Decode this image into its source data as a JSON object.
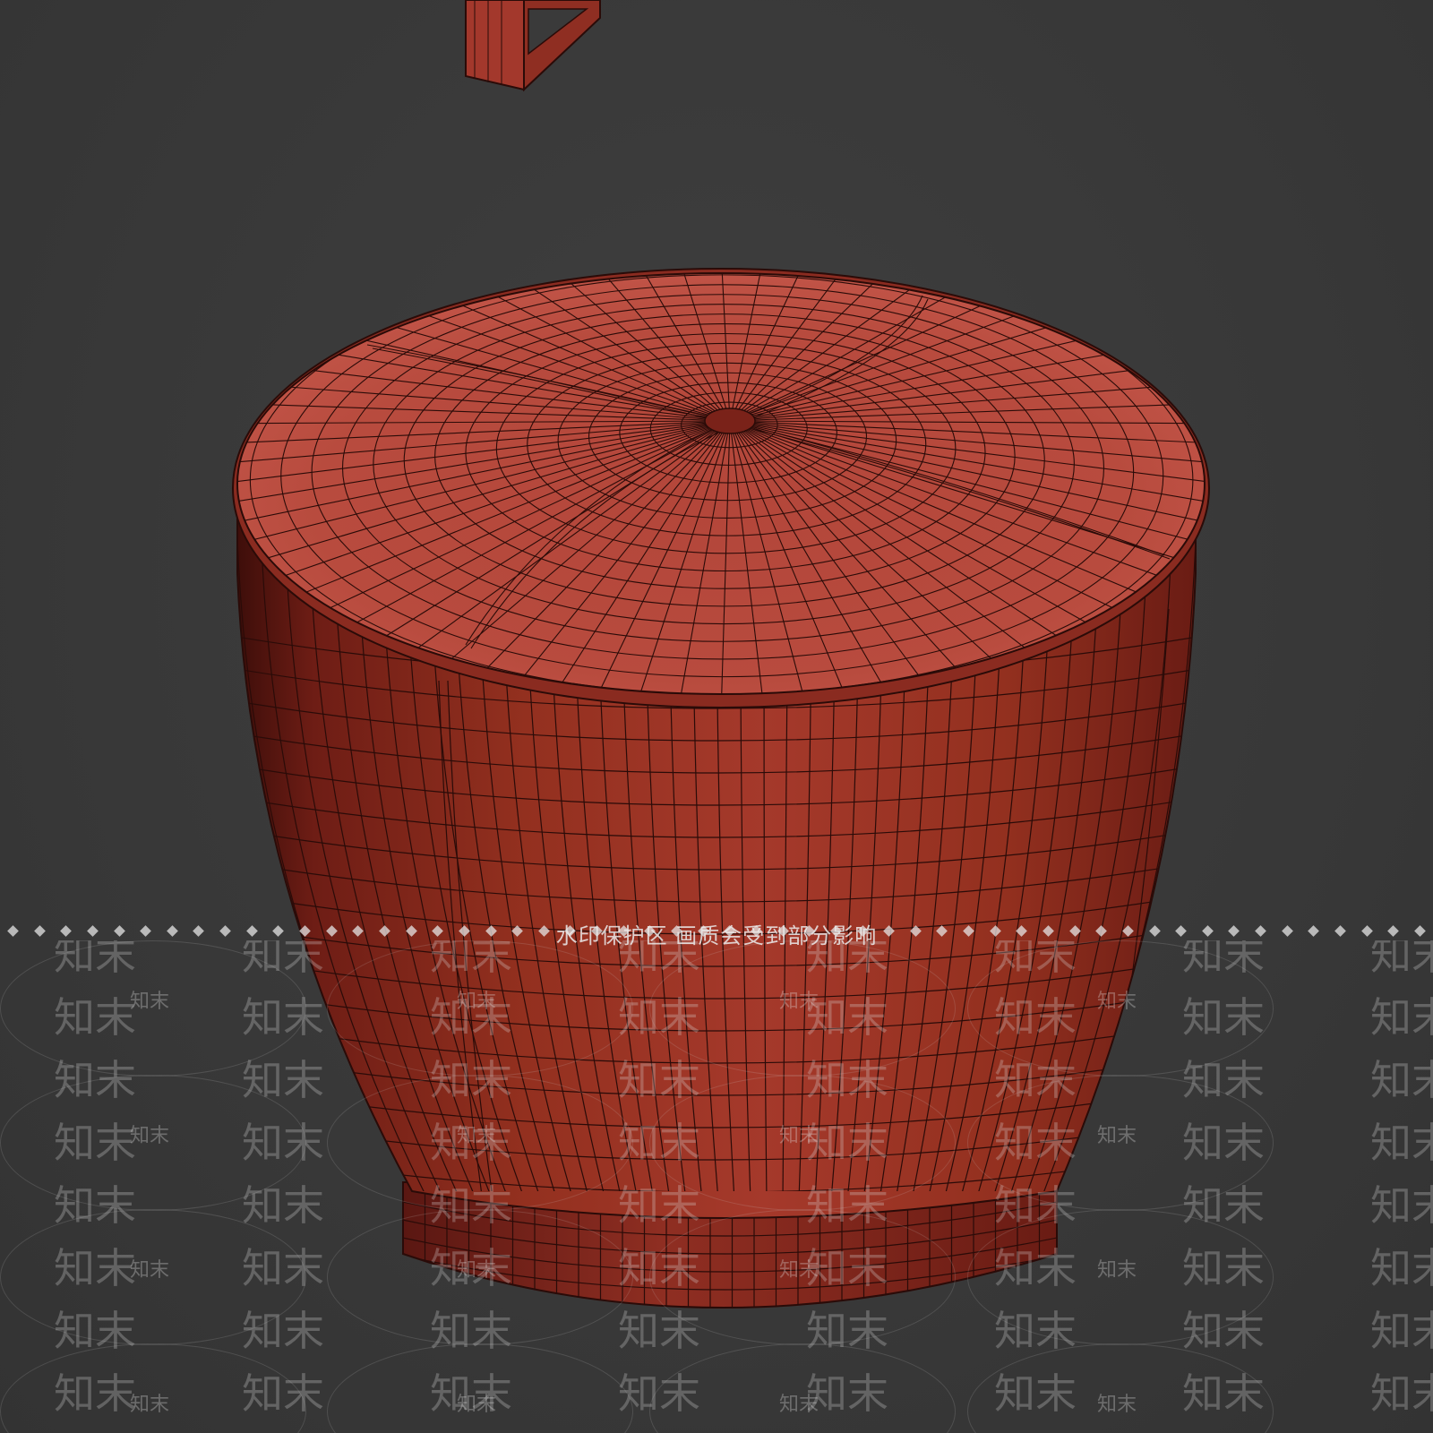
{
  "viewport": {
    "background_color": "#3a3a3a",
    "subject": "ottoman-wireframe"
  },
  "model": {
    "surface_color": "#a3382c",
    "highlight_color": "#c9564a",
    "shadow_color": "#5a1712",
    "wire_color": "#2a0b08"
  },
  "watermark": {
    "band_text": "水印保护区   画质会受到部分影响",
    "tile_text": "知末",
    "small_text": "知末"
  }
}
